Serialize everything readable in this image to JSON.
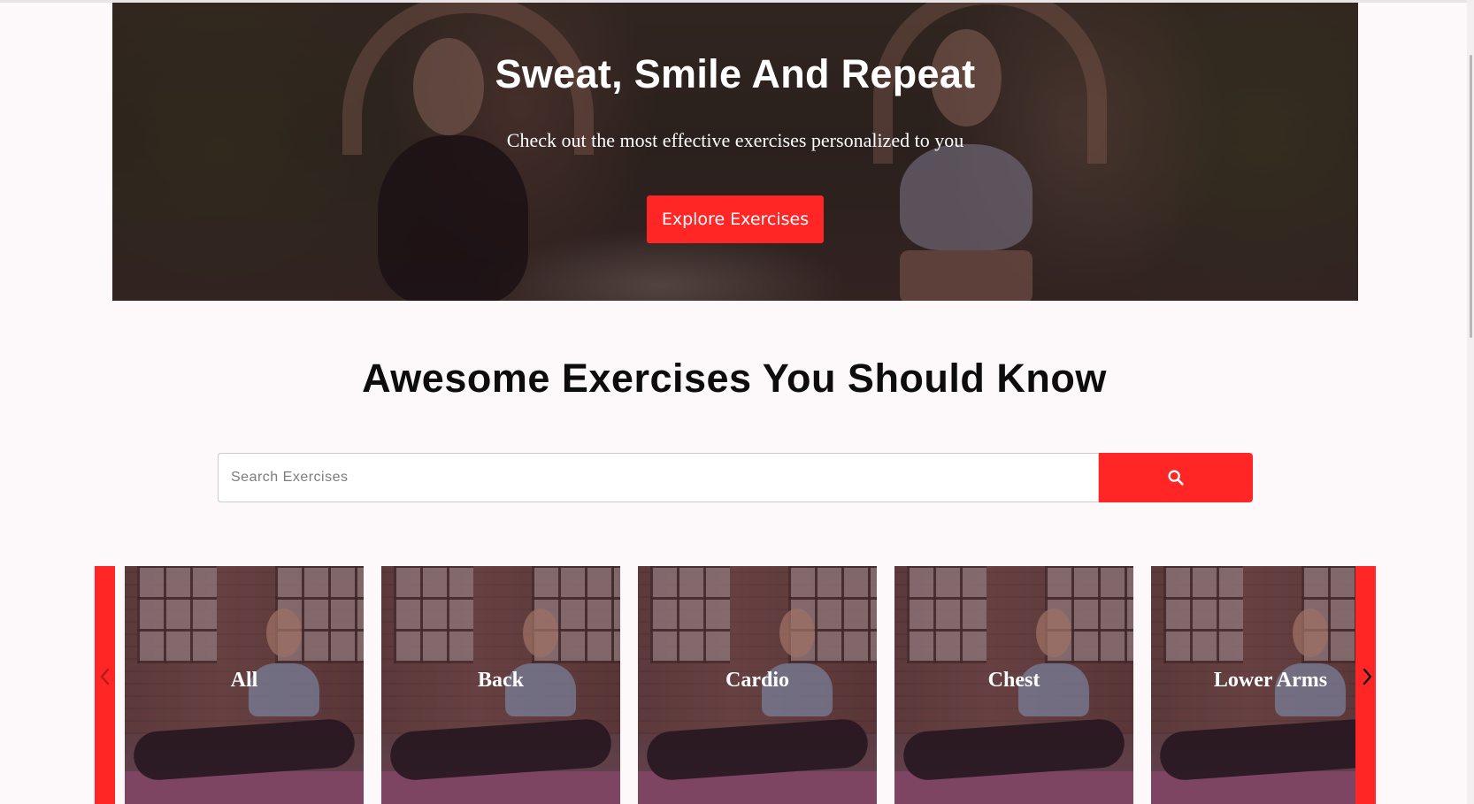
{
  "hero": {
    "title": "Sweat, Smile And Repeat",
    "subtitle": "Check out the most effective exercises personalized to you",
    "button_label": "Explore Exercises"
  },
  "section": {
    "title": "Awesome Exercises You Should Know"
  },
  "search": {
    "placeholder": "Search Exercises",
    "value": "",
    "button_icon": "search-icon"
  },
  "categories": {
    "items": [
      {
        "label": "All"
      },
      {
        "label": "Back"
      },
      {
        "label": "Cardio"
      },
      {
        "label": "Chest"
      },
      {
        "label": "Lower Arms"
      }
    ],
    "prev_icon": "chevron-left-icon",
    "next_icon": "chevron-right-icon"
  },
  "colors": {
    "accent": "#ff2625",
    "background": "#fdf8f9",
    "heading": "#0d0d0d"
  }
}
